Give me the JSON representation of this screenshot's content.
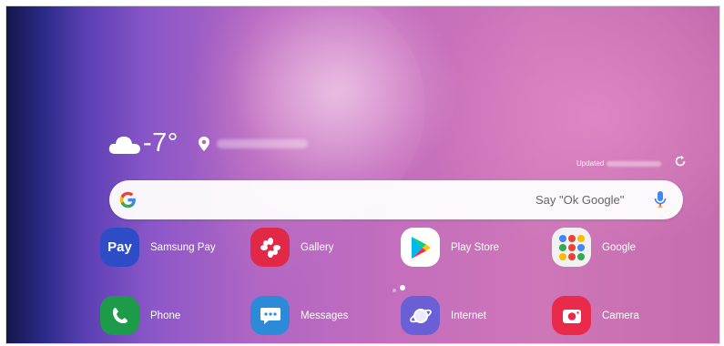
{
  "weather": {
    "temperature": "-7°",
    "icon": "cloud-icon",
    "location_icon": "location-pin-icon",
    "updated_label": "Updated"
  },
  "search": {
    "voice_hint": "Say \"Ok Google\"",
    "logo_icon": "google-g-icon",
    "mic_icon": "microphone-icon"
  },
  "apps": {
    "row1": [
      {
        "label": "Samsung Pay",
        "icon": "samsung-pay-icon",
        "icon_text": "Pay",
        "color": "#2e4cc6"
      },
      {
        "label": "Gallery",
        "icon": "gallery-icon",
        "color": "#e22847"
      },
      {
        "label": "Play Store",
        "icon": "play-store-icon",
        "color": "#ffffff"
      },
      {
        "label": "Google",
        "icon": "google-folder-icon",
        "color": "#f1f1f1"
      }
    ],
    "row2": [
      {
        "label": "Phone",
        "icon": "phone-icon",
        "color": "#1d9b4a"
      },
      {
        "label": "Messages",
        "icon": "messages-icon",
        "color": "#2d8ad8"
      },
      {
        "label": "Internet",
        "icon": "internet-icon",
        "color": "#6b5fd6"
      },
      {
        "label": "Camera",
        "icon": "camera-icon",
        "color": "#e92a4a"
      }
    ]
  },
  "page_indicator": {
    "pages": 2,
    "current": 2
  }
}
